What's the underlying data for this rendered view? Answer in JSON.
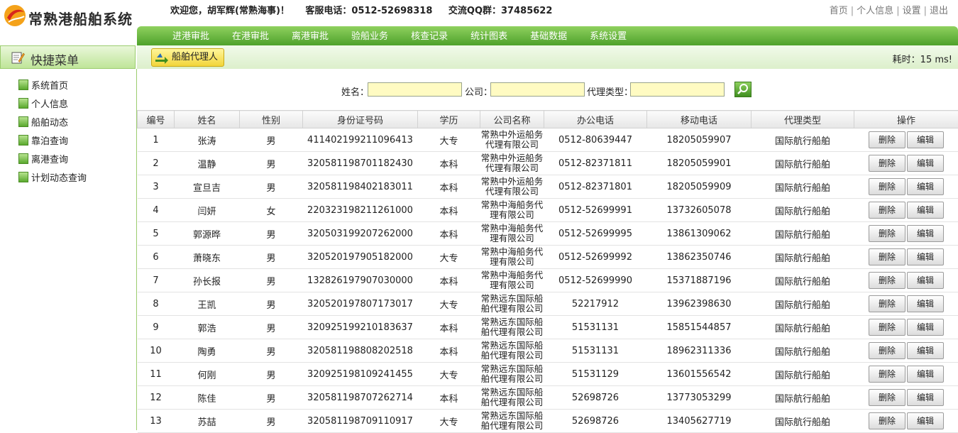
{
  "app": {
    "title": "常熟港船舶系统"
  },
  "header": {
    "welcome": "欢迎您，胡军辉(常熟海事)！",
    "hotline": "客服电话：0512-52698318",
    "qq": "交流QQ群：37485622",
    "links": [
      "首页",
      "个人信息",
      "设置",
      "退出"
    ]
  },
  "nav": [
    "进港审批",
    "在港审批",
    "离港审批",
    "验船业务",
    "核查记录",
    "统计图表",
    "基础数据",
    "系统设置"
  ],
  "sidebar": {
    "title": "快捷菜单",
    "items": [
      "系统首页",
      "个人信息",
      "船舶动态",
      "靠泊查询",
      "离港查询",
      "计划动态查询"
    ]
  },
  "toolbar": {
    "tab": "船舶代理人",
    "timing": "耗时：15 ms!"
  },
  "search": {
    "name_label": "姓名：",
    "company_label": "公司：",
    "agent_type_label": "代理类型："
  },
  "table": {
    "headers": [
      "编号",
      "姓名",
      "性别",
      "身份证号码",
      "学历",
      "公司名称",
      "办公电话",
      "移动电话",
      "代理类型",
      "操作"
    ],
    "delete_label": "删除",
    "edit_label": "编辑",
    "rows": [
      [
        "1",
        "张涛",
        "男",
        "411402199211096413",
        "大专",
        "常熟中外运船务代理有限公司",
        "0512-80639447",
        "18205059907",
        "国际航行船舶"
      ],
      [
        "2",
        "温静",
        "男",
        "320581198701182430",
        "本科",
        "常熟中外运船务代理有限公司",
        "0512-82371811",
        "18205059901",
        "国际航行船舶"
      ],
      [
        "3",
        "宣旦吉",
        "男",
        "320581198402183011",
        "本科",
        "常熟中外运船务代理有限公司",
        "0512-82371801",
        "18205059909",
        "国际航行船舶"
      ],
      [
        "4",
        "闫妍",
        "女",
        "220323198211261000",
        "本科",
        "常熟中海船务代理有限公司",
        "0512-52699991",
        "13732605078",
        "国际航行船舶"
      ],
      [
        "5",
        "郭源晔",
        "男",
        "320503199207262000",
        "本科",
        "常熟中海船务代理有限公司",
        "0512-52699995",
        "13861309062",
        "国际航行船舶"
      ],
      [
        "6",
        "萧晓东",
        "男",
        "320520197905182000",
        "大专",
        "常熟中海船务代理有限公司",
        "0512-52699992",
        "13862350746",
        "国际航行船舶"
      ],
      [
        "7",
        "孙长报",
        "男",
        "132826197907030000",
        "本科",
        "常熟中海船务代理有限公司",
        "0512-52699990",
        "15371887196",
        "国际航行船舶"
      ],
      [
        "8",
        "王凯",
        "男",
        "320520197807173017",
        "大专",
        "常熟远东国际船舶代理有限公司",
        "52217912",
        "13962398630",
        "国际航行船舶"
      ],
      [
        "9",
        "郭浩",
        "男",
        "320925199210183637",
        "本科",
        "常熟远东国际船舶代理有限公司",
        "51531131",
        "15851544857",
        "国际航行船舶"
      ],
      [
        "10",
        "陶勇",
        "男",
        "320581198808202518",
        "本科",
        "常熟远东国际船舶代理有限公司",
        "51531131",
        "18962311336",
        "国际航行船舶"
      ],
      [
        "11",
        "何刚",
        "男",
        "320925198109241455",
        "大专",
        "常熟远东国际船舶代理有限公司",
        "51531129",
        "13601556542",
        "国际航行船舶"
      ],
      [
        "12",
        "陈佳",
        "男",
        "320581198707262714",
        "本科",
        "常熟远东国际船舶代理有限公司",
        "52698726",
        "13773053299",
        "国际航行船舶"
      ],
      [
        "13",
        "苏喆",
        "男",
        "320581198709110917",
        "大专",
        "常熟远东国际船舶代理有限公司",
        "52698726",
        "13405627719",
        "国际航行船舶"
      ]
    ]
  },
  "colors": {
    "nav_green": "#4ea12b",
    "input_yellow": "#fffbc2",
    "tab_yellow": "#f2d53a"
  }
}
